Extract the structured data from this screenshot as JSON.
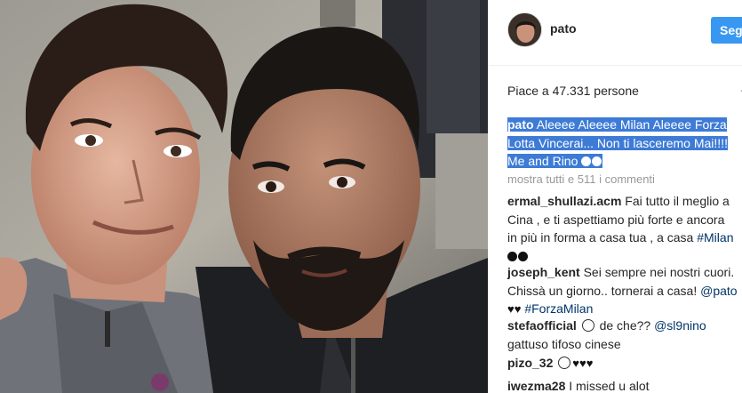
{
  "post": {
    "username": "pato",
    "follow_label": "Segui",
    "likes_text": "Piace a 47.331 persone",
    "more_icon": "ellipsis-icon",
    "caption": {
      "author": "pato",
      "line1": "Aleeee Aleeee Milan Aleeee Forza",
      "line2": "Lotta Vincerai... Non ti lasceremo Mai!!!!",
      "line3": "Me and Rino"
    },
    "load_more": "mostra tutti e 511 i commenti"
  },
  "comments": [
    {
      "user": "ermal_shullazi.acm",
      "text1": "Fai tutto il meglio a",
      "text2": "Cina , e ti aspettiamo più forte e ancora",
      "text3": "in più in forma a casa tua , a casa",
      "tag": "#Milan"
    },
    {
      "user": "joseph_kent",
      "text1": "Sei sempre nei nostri cuori.",
      "text2": "Chissà un giorno.. tornerai a casa!",
      "mention": "@pato",
      "tag": "#ForzaMilan"
    },
    {
      "user": "stefaofficial",
      "text1": "de che??",
      "mention": "@sl9nino",
      "text2": "gattuso tifoso cinese"
    },
    {
      "user": "pizo_32",
      "hearts": "♥♥♥"
    },
    {
      "user": "iwezma28",
      "text1": "I missed u alot"
    }
  ],
  "colors": {
    "accent": "#3897f0",
    "highlight": "#3d7bd6",
    "link": "#003569",
    "muted": "#999999"
  }
}
